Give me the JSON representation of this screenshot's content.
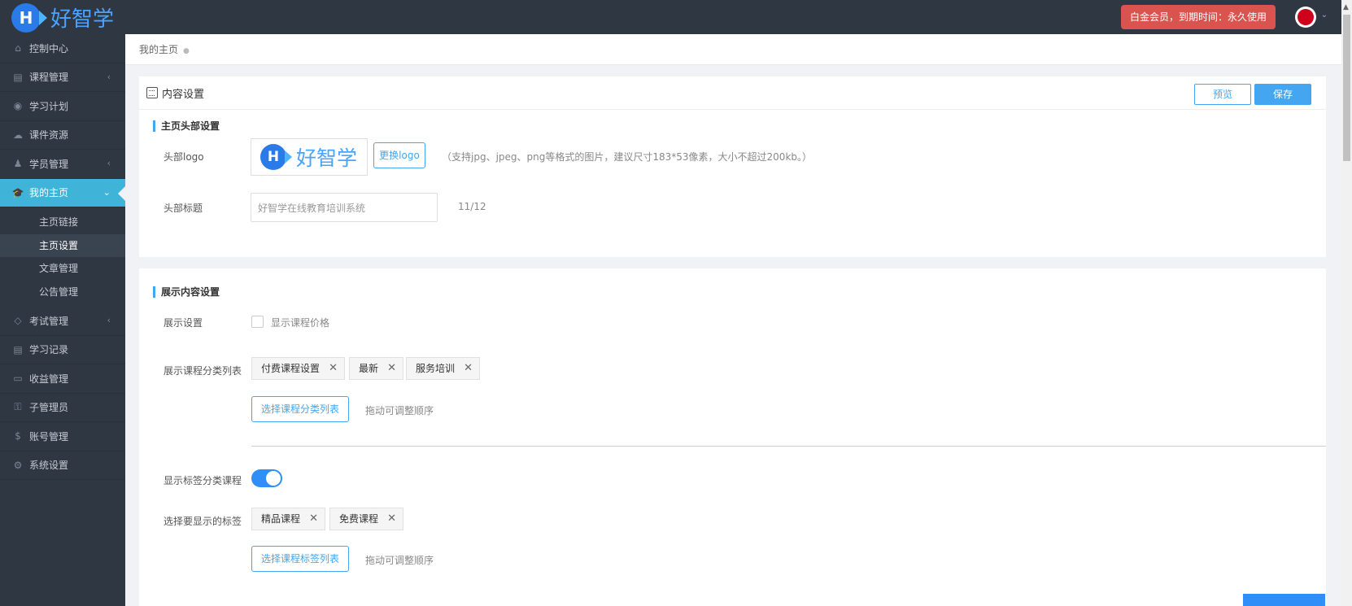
{
  "app": {
    "logo_letter": "H",
    "logo_text": "好智学"
  },
  "header": {
    "member_badge": "白金会员，到期时间：永久使用",
    "avatar_caret": "⌄"
  },
  "sidebar": {
    "items": [
      {
        "label": "控制中心",
        "icon": "home-icon",
        "glyph": "⌂"
      },
      {
        "label": "课程管理",
        "icon": "book-icon",
        "glyph": "▤",
        "arrow": "‹"
      },
      {
        "label": "学习计划",
        "icon": "eye-icon",
        "glyph": "◉"
      },
      {
        "label": "课件资源",
        "icon": "cloud-icon",
        "glyph": "☁"
      },
      {
        "label": "学员管理",
        "icon": "users-icon",
        "glyph": "♟",
        "arrow": "‹"
      },
      {
        "label": "我的主页",
        "icon": "graduation-cap-icon",
        "glyph": "🎓",
        "arrow": "⌄"
      },
      {
        "label": "考试管理",
        "icon": "tag-icon",
        "glyph": "◇",
        "arrow": "‹"
      },
      {
        "label": "学习记录",
        "icon": "notebook-icon",
        "glyph": "▤"
      },
      {
        "label": "收益管理",
        "icon": "credit-card-icon",
        "glyph": "▭"
      },
      {
        "label": "子管理员",
        "icon": "lock-icon",
        "glyph": "⚿"
      },
      {
        "label": "账号管理",
        "icon": "dollar-icon",
        "glyph": "$"
      },
      {
        "label": "系统设置",
        "icon": "gear-icon",
        "glyph": "⚙"
      }
    ],
    "sub_items": [
      "主页链接",
      "主页设置",
      "文章管理",
      "公告管理"
    ]
  },
  "breadcrumb": {
    "current": "我的主页",
    "sep": "●"
  },
  "content": {
    "title": "内容设置",
    "preview_label": "预览",
    "save_label": "保存",
    "header_section": {
      "title": "主页头部设置",
      "logo_label": "头部logo",
      "change_logo_label": "更换logo",
      "logo_hint": "（支持jpg、jpeg、png等格式的图片，建议尺寸183*53像素，大小不超过200kb。）",
      "title_label": "头部标题",
      "title_value": "好智学在线教育培训系统",
      "title_counter": "11/12"
    },
    "display_section": {
      "title": "展示内容设置",
      "display_label": "展示设置",
      "show_price_label": "显示课程价格",
      "category_list_label": "展示课程分类列表",
      "category_tags": [
        "付费课程设置",
        "最新",
        "服务培训"
      ],
      "select_category_label": "选择课程分类列表",
      "drag_hint": "拖动可调整顺序",
      "show_tag_course_label": "显示标签分类课程",
      "select_tags_label": "选择要显示的标签",
      "course_tags": [
        "精品课程",
        "免费课程"
      ],
      "select_tag_list_label": "选择课程标签列表",
      "drag_hint2": "拖动可调整顺序"
    },
    "tag_close": "✕"
  },
  "colors": {
    "sidebar_bg": "#2f3743",
    "accent": "#44a6f0",
    "active_nav": "#40b3d8",
    "badge": "#d9534f"
  }
}
